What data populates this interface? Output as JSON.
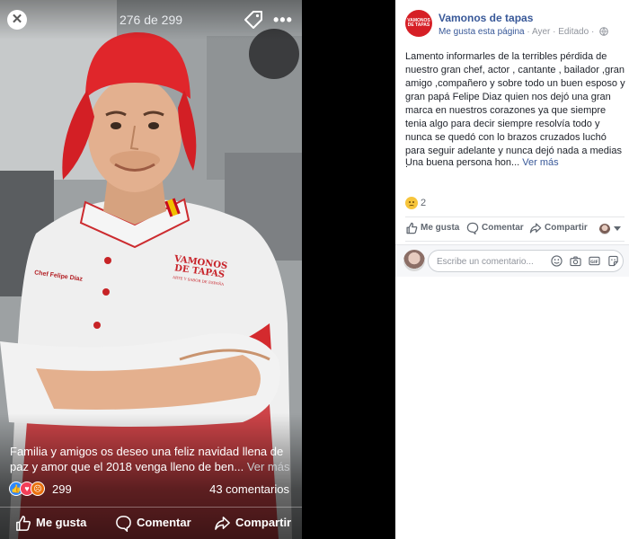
{
  "viewer": {
    "counter": "276 de 299",
    "caption": "Familia y amigos os deseo una feliz navidad llena de paz y amor que el 2018 venga lleno de ben...",
    "caption_more": "Ver más",
    "chef_embroidery": "Chef Felipe Díaz",
    "logo_line1": "VAMONOS",
    "logo_line2": "DE TAPAS",
    "logo_sub": "ARTE Y SABOR DE ESPAÑA",
    "reaction_count": "299",
    "comments_count": "43 comentarios",
    "actions": {
      "like": "Me gusta",
      "comment": "Comentar",
      "share": "Compartir"
    }
  },
  "post": {
    "page_name": "Vamonos de tapas",
    "avatar_logo_top": "VAMONOS",
    "avatar_logo_bottom": "DE TAPAS",
    "like_page": "Me gusta esta página",
    "meta_sep": " · ",
    "time": "Ayer",
    "edited": "Editado",
    "meta_dot": " · ",
    "body": "Lamento informarles de la terribles pérdida de nuestro gran chef, actor , cantante , bailador ,gran amigo ,compañero y sobre todo un buen esposo y gran papá Felipe Diaz quien nos dejó una gran marca en nuestros corazones ya que siempre tenia algo para decir siempre resolvía todo y nunca se quedó con lo brazos cruzados luchó para seguir adelante y nunca dejó nada a medias .",
    "body2": "Una buena persona hon...",
    "see_more": "Ver más",
    "reaction_count": "2",
    "actions": {
      "like": "Me gusta",
      "comment": "Comentar",
      "share": "Compartir"
    },
    "comment_placeholder": "Escribe un comentario..."
  },
  "colors": {
    "facebook_blue": "#385898",
    "brand_red": "#d61f26",
    "sad_yellow": "#f7c53c"
  }
}
